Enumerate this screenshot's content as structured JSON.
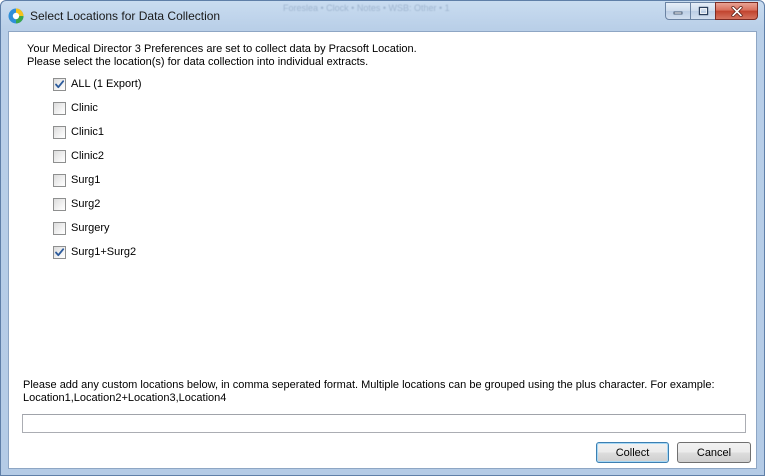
{
  "window": {
    "title": "Select Locations for Data Collection",
    "background_title": "Foreslea • Clock • Notes • WSB: Other • 1"
  },
  "intro": {
    "line1": "Your Medical Director 3 Preferences are set to collect data by Pracsoft Location.",
    "line2": "Please select the location(s) for data collection into individual extracts."
  },
  "locations": [
    {
      "label": "ALL (1 Export)",
      "checked": true
    },
    {
      "label": "Clinic",
      "checked": false
    },
    {
      "label": "Clinic1",
      "checked": false
    },
    {
      "label": "Clinic2",
      "checked": false
    },
    {
      "label": "Surg1",
      "checked": false
    },
    {
      "label": "Surg2",
      "checked": false
    },
    {
      "label": "Surgery",
      "checked": false
    },
    {
      "label": "Surg1+Surg2",
      "checked": true
    }
  ],
  "custom": {
    "note_line1": "Please add any custom locations below, in comma seperated format. Multiple locations can be grouped using the plus character. For example:",
    "note_line2": "Location1,Location2+Location3,Location4",
    "value": ""
  },
  "buttons": {
    "collect": "Collect",
    "cancel": "Cancel"
  },
  "colors": {
    "check": "#2c5b9c",
    "close_button": "#c1432e",
    "title_bar": "#b9cfe8"
  }
}
